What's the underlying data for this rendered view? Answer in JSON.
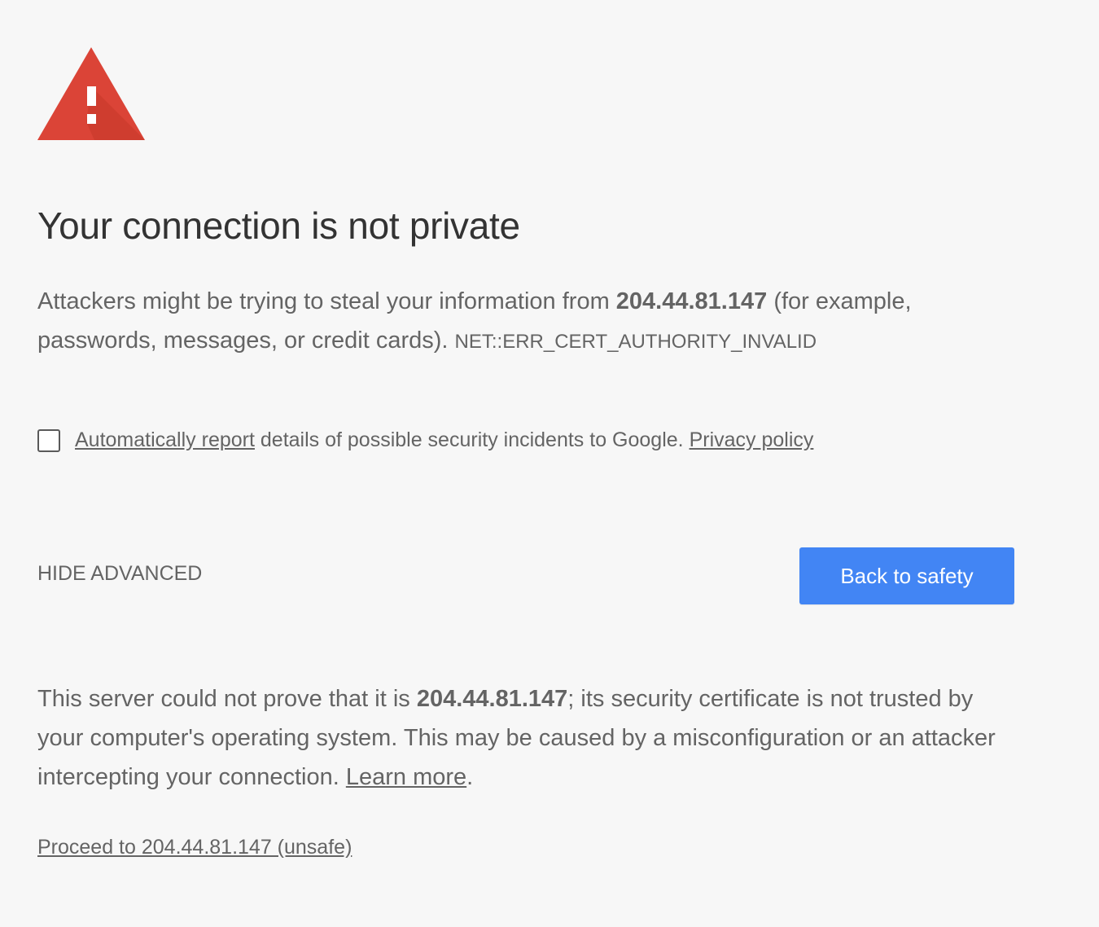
{
  "icon": {
    "name": "warning-triangle-icon",
    "color": "#db4437"
  },
  "title": "Your connection is not private",
  "explanation": {
    "before": "Attackers might be trying to steal your information from ",
    "host": "204.44.81.147",
    "after": " (for example, passwords, messages, or credit cards). ",
    "error_code": "NET::ERR_CERT_AUTHORITY_INVALID"
  },
  "report": {
    "checked": false,
    "link_label": "Automatically report",
    "text": " details of possible security incidents to Google. ",
    "privacy_label": "Privacy policy"
  },
  "actions": {
    "hide_advanced_label": "HIDE ADVANCED",
    "back_label": "Back to safety",
    "back_color": "#4285f4"
  },
  "details": {
    "before": "This server could not prove that it is ",
    "host": "204.44.81.147",
    "after": "; its security certificate is not trusted by your computer's operating system. This may be caused by a misconfiguration or an attacker intercepting your connection. ",
    "learn_more_label": "Learn more",
    "end": "."
  },
  "proceed_label": "Proceed to 204.44.81.147 (unsafe)"
}
